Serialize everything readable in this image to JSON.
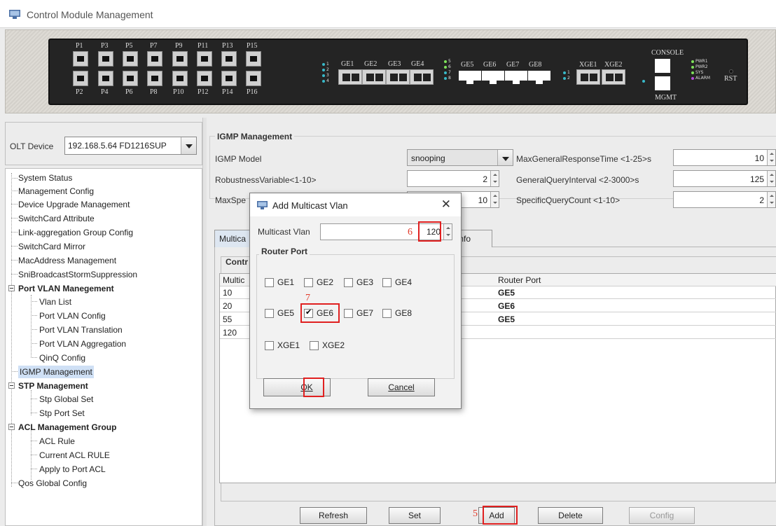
{
  "window": {
    "title": "Control Module Management"
  },
  "device_panel": {
    "ports_top": [
      "P1",
      "P3",
      "P5",
      "P7",
      "P9",
      "P11",
      "P13",
      "P15"
    ],
    "ports_bottom": [
      "P2",
      "P4",
      "P6",
      "P8",
      "P10",
      "P12",
      "P14",
      "P16"
    ],
    "led_group1": [
      "1",
      "2",
      "3",
      "4"
    ],
    "ge_ports_a": [
      "GE1",
      "GE2",
      "GE3",
      "GE4"
    ],
    "led_group2": [
      "5",
      "6",
      "7",
      "8"
    ],
    "ge_ports_b": [
      "GE5",
      "GE6",
      "GE7",
      "GE8"
    ],
    "led_group3": [
      "1",
      "2"
    ],
    "xge_ports": [
      "XGE1",
      "XGE2"
    ],
    "console_label": "CONSOLE",
    "mgmt_label": "MGMT",
    "status_leds": [
      "PWR1",
      "PWR2",
      "SYS",
      "ALARM"
    ],
    "rst_label": "RST"
  },
  "sidebar": {
    "olt_label": "OLT Device",
    "olt_value": "192.168.5.64 FD1216SUP",
    "tree": [
      "System Status",
      "Management Config",
      "Device Upgrade Management",
      "SwitchCard Attribute",
      "Link-aggregation Group Config",
      "SwitchCard Mirror",
      "MacAddress Management",
      "SniBroadcastStormSuppression",
      "Port VLAN Manegement",
      "Vlan List",
      "Port VLAN Config",
      "Port VLAN Translation",
      "Port VLAN Aggregation",
      "QinQ Config",
      "IGMP Management",
      "STP Management",
      "Stp Global Set",
      "Stp Port Set",
      "ACL Management Group",
      "ACL Rule",
      "Current ACL RULE",
      "Apply to Port ACL",
      "Qos Global Config"
    ]
  },
  "igmp": {
    "section_title": "IGMP Management",
    "model_label": "IGMP Model",
    "model_value": "snooping",
    "robust_label": "RobustnessVariable<1-10>",
    "robust_value": "2",
    "maxspec_label": "MaxSpe",
    "maxspec_value": "10",
    "maxgen_label": "MaxGeneralResponseTime <1-25>s",
    "maxgen_value": "10",
    "genquery_label": "GeneralQueryInterval <2-3000>s",
    "genquery_value": "125",
    "specquery_label": "SpecificQueryCount <1-10>",
    "specquery_value": "2"
  },
  "tabs": {
    "tab1": "Multica",
    "tab2": "rd Info"
  },
  "control": {
    "title": "Contr",
    "col1": "Multic",
    "col_router": "Router Port",
    "rows": [
      {
        "vlan": "10",
        "router": "GE5"
      },
      {
        "vlan": "20",
        "router": "GE6"
      },
      {
        "vlan": "55",
        "router": "GE5"
      },
      {
        "vlan": "120",
        "router": ""
      }
    ]
  },
  "buttons": {
    "refresh": "Refresh",
    "set": "Set",
    "add": "Add",
    "delete": "Delete",
    "config": "Config"
  },
  "dialog": {
    "title": "Add Multicast Vlan",
    "close": "✕",
    "vlan_label": "Multicast Vlan",
    "vlan_value": "120",
    "router_section": "Router Port",
    "ports_row1": [
      "GE1",
      "GE2",
      "GE3",
      "GE4"
    ],
    "ports_row2": [
      "GE5",
      "GE6",
      "GE7",
      "GE8"
    ],
    "ports_row3": [
      "XGE1",
      "XGE2"
    ],
    "checked_port": "GE6",
    "ok": "OK",
    "cancel": "Cancel"
  },
  "annotations": {
    "n5": "5",
    "n6": "6",
    "n7": "7",
    "n8": "8"
  }
}
